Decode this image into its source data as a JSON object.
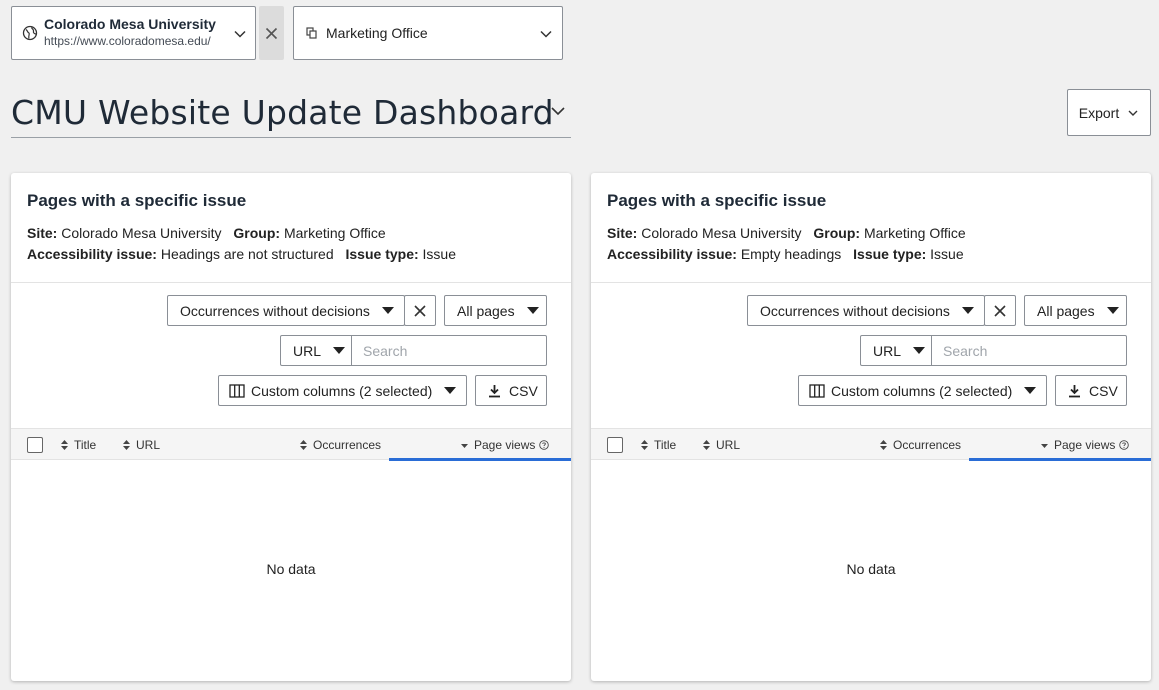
{
  "site_selector": {
    "name": "Colorado Mesa University",
    "url": "https://www.coloradomesa.edu/",
    "icon": "globe-icon"
  },
  "group_selector": {
    "label": "Marketing Office",
    "icon": "group-icon"
  },
  "dashboard": {
    "title": "CMU Website Update Dashboard"
  },
  "export": {
    "label": "Export"
  },
  "panels": [
    {
      "title": "Pages with a specific issue",
      "site_label": "Site:",
      "site_value": "Colorado Mesa University",
      "group_label": "Group:",
      "group_value": "Marketing Office",
      "issue_label": "Accessibility issue:",
      "issue_value": "Headings are not structured",
      "type_label": "Issue type:",
      "type_value": "Issue",
      "occurrence_filter": "Occurrences without decisions",
      "pages_filter": "All pages",
      "search_field": "URL",
      "search_placeholder": "Search",
      "columns_label": "Custom columns (2 selected)",
      "csv_label": "CSV",
      "columns": [
        "Title",
        "URL",
        "Occurrences",
        "Page views"
      ],
      "empty_text": "No data"
    },
    {
      "title": "Pages with a specific issue",
      "site_label": "Site:",
      "site_value": "Colorado Mesa University",
      "group_label": "Group:",
      "group_value": "Marketing Office",
      "issue_label": "Accessibility issue:",
      "issue_value": "Empty headings",
      "type_label": "Issue type:",
      "type_value": "Issue",
      "occurrence_filter": "Occurrences without decisions",
      "pages_filter": "All pages",
      "search_field": "URL",
      "search_placeholder": "Search",
      "columns_label": "Custom columns (2 selected)",
      "csv_label": "CSV",
      "columns": [
        "Title",
        "URL",
        "Occurrences",
        "Page views"
      ],
      "empty_text": "No data"
    }
  ],
  "colors": {
    "accent": "#2a6dd6",
    "background": "#f0f0f0",
    "text": "#1f2a37"
  }
}
